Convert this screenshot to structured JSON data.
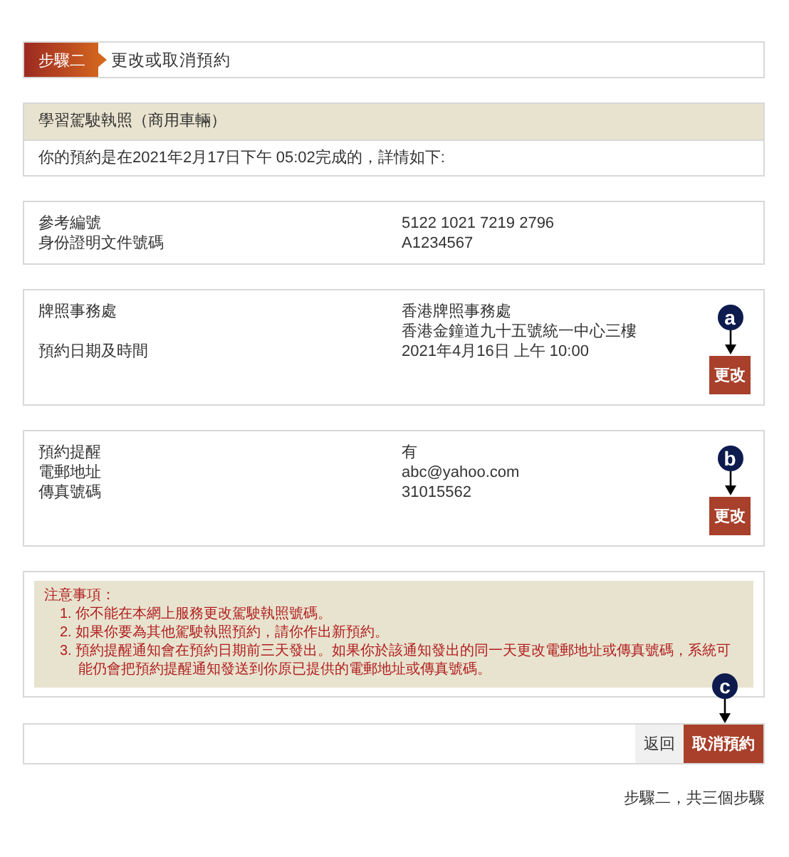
{
  "step_header": {
    "step": "步驟二",
    "title": "更改或取消預約"
  },
  "booking_summary": {
    "title": "學習駕駛執照（商用車輛）",
    "message": "你的預約是在2021年2月17日下午 05:02完成的，詳情如下:"
  },
  "details": [
    {
      "rows": [
        {
          "label": "參考編號",
          "value": [
            "5122 1021 7219 2796"
          ]
        },
        {
          "label": "身份證明文件號碼",
          "value": [
            "A1234567"
          ]
        }
      ]
    },
    {
      "rows": [
        {
          "label": "牌照事務處",
          "value": [
            "香港牌照事務處",
            "香港金鐘道九十五號統一中心三樓"
          ]
        },
        {
          "label": "預約日期及時間",
          "value": [
            "2021年4月16日 上午 10:00"
          ]
        }
      ],
      "callout": "a",
      "button": "更改"
    },
    {
      "rows": [
        {
          "label": "預約提醒",
          "value": [
            "有"
          ]
        },
        {
          "label": "電郵地址",
          "value": [
            "abc@yahoo.com"
          ]
        },
        {
          "label": "傳真號碼",
          "value": [
            "31015562"
          ]
        }
      ],
      "callout": "b",
      "button": "更改"
    }
  ],
  "notes": {
    "title": "注意事項：",
    "items": [
      "1. 你不能在本網上服務更改駕駛執照號碼。",
      "2. 如果你要為其他駕駛執照預約，請你作出新預約。",
      "3. 預約提醒通知會在預約日期前三天發出。如果你於該通知發出的同一天更改電郵地址或傳真號碼，系統可能仍會把預約提醒通知發送到你原已提供的電郵地址或傳真號碼。"
    ]
  },
  "actions": {
    "back": "返回",
    "cancel": "取消預約",
    "callout": "c"
  },
  "footer": "步驟二，共三個步驟"
}
